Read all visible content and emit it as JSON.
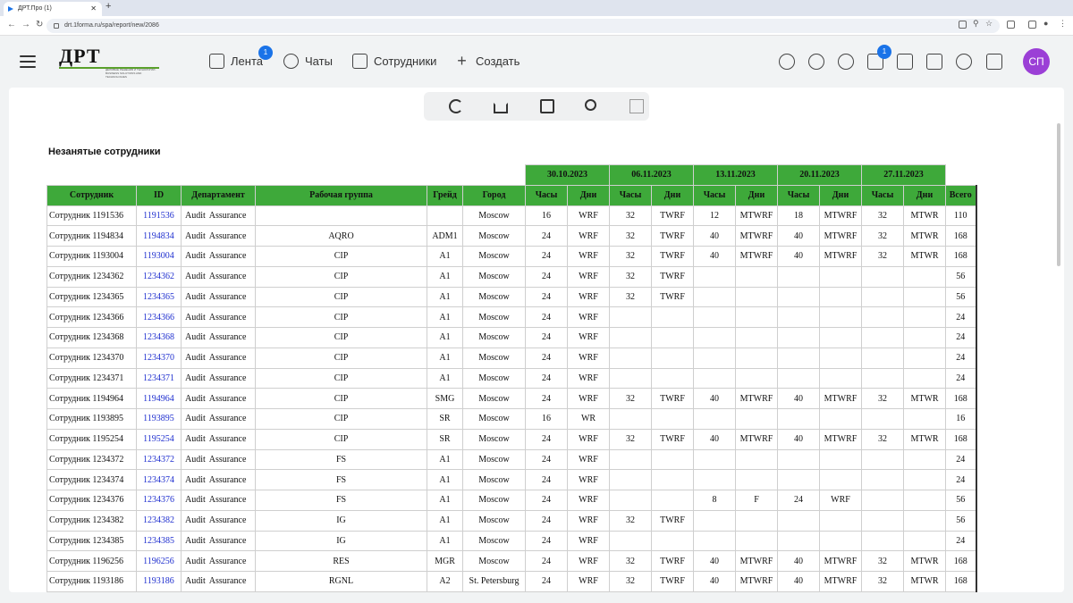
{
  "browser": {
    "tab_title": "ДРТ.Про (1)",
    "url": "drt.1forma.ru/spa/report/new/2086"
  },
  "header": {
    "logo": "ДРТ",
    "logo_sub": "ДЕЛОВЫЕ РЕШЕНИЯ И ТЕХНОЛОГИИ · BUSINESS SOLUTIONS AND TECHNOLOGIES",
    "nav": {
      "feed": "Лента",
      "feed_badge": "1",
      "chats": "Чаты",
      "employees": "Сотрудники",
      "create": "Создать"
    },
    "mail_badge": "1",
    "avatar": "СП"
  },
  "report": {
    "title": "Незанятые сотрудники",
    "weeks": [
      "30.10.2023",
      "06.11.2023",
      "13.11.2023",
      "20.11.2023",
      "27.11.2023"
    ],
    "columns": {
      "employee": "Сотрудник",
      "id": "ID",
      "department": "Департамент",
      "workgroup": "Рабочая группа",
      "grade": "Грейд",
      "city": "Город",
      "hours": "Часы",
      "days": "Дни",
      "total": "Всего"
    },
    "rows": [
      {
        "name": "Сотрудник 1191536",
        "id": "1191536",
        "dept": "Audit  Assurance",
        "group": "",
        "grade": "",
        "city": "Moscow",
        "w": [
          "16",
          "WRF",
          "32",
          "TWRF",
          "12",
          "MTWRF",
          "18",
          "MTWRF",
          "32",
          "MTWR"
        ],
        "total": "110"
      },
      {
        "name": "Сотрудник 1194834",
        "id": "1194834",
        "dept": "Audit  Assurance",
        "group": "AQRO",
        "grade": "ADM1",
        "city": "Moscow",
        "w": [
          "24",
          "WRF",
          "32",
          "TWRF",
          "40",
          "MTWRF",
          "40",
          "MTWRF",
          "32",
          "MTWR"
        ],
        "total": "168"
      },
      {
        "name": "Сотрудник 1193004",
        "id": "1193004",
        "dept": "Audit  Assurance",
        "group": "CIP",
        "grade": "A1",
        "city": "Moscow",
        "w": [
          "24",
          "WRF",
          "32",
          "TWRF",
          "40",
          "MTWRF",
          "40",
          "MTWRF",
          "32",
          "MTWR"
        ],
        "total": "168"
      },
      {
        "name": "Сотрудник 1234362",
        "id": "1234362",
        "dept": "Audit  Assurance",
        "group": "CIP",
        "grade": "A1",
        "city": "Moscow",
        "w": [
          "24",
          "WRF",
          "32",
          "TWRF",
          "",
          "",
          "",
          "",
          "",
          ""
        ],
        "total": "56"
      },
      {
        "name": "Сотрудник 1234365",
        "id": "1234365",
        "dept": "Audit  Assurance",
        "group": "CIP",
        "grade": "A1",
        "city": "Moscow",
        "w": [
          "24",
          "WRF",
          "32",
          "TWRF",
          "",
          "",
          "",
          "",
          "",
          ""
        ],
        "total": "56"
      },
      {
        "name": "Сотрудник 1234366",
        "id": "1234366",
        "dept": "Audit  Assurance",
        "group": "CIP",
        "grade": "A1",
        "city": "Moscow",
        "w": [
          "24",
          "WRF",
          "",
          "",
          "",
          "",
          "",
          "",
          "",
          ""
        ],
        "total": "24"
      },
      {
        "name": "Сотрудник 1234368",
        "id": "1234368",
        "dept": "Audit  Assurance",
        "group": "CIP",
        "grade": "A1",
        "city": "Moscow",
        "w": [
          "24",
          "WRF",
          "",
          "",
          "",
          "",
          "",
          "",
          "",
          ""
        ],
        "total": "24"
      },
      {
        "name": "Сотрудник 1234370",
        "id": "1234370",
        "dept": "Audit  Assurance",
        "group": "CIP",
        "grade": "A1",
        "city": "Moscow",
        "w": [
          "24",
          "WRF",
          "",
          "",
          "",
          "",
          "",
          "",
          "",
          ""
        ],
        "total": "24"
      },
      {
        "name": "Сотрудник 1234371",
        "id": "1234371",
        "dept": "Audit  Assurance",
        "group": "CIP",
        "grade": "A1",
        "city": "Moscow",
        "w": [
          "24",
          "WRF",
          "",
          "",
          "",
          "",
          "",
          "",
          "",
          ""
        ],
        "total": "24"
      },
      {
        "name": "Сотрудник 1194964",
        "id": "1194964",
        "dept": "Audit  Assurance",
        "group": "CIP",
        "grade": "SMG",
        "city": "Moscow",
        "w": [
          "24",
          "WRF",
          "32",
          "TWRF",
          "40",
          "MTWRF",
          "40",
          "MTWRF",
          "32",
          "MTWR"
        ],
        "total": "168"
      },
      {
        "name": "Сотрудник 1193895",
        "id": "1193895",
        "dept": "Audit  Assurance",
        "group": "CIP",
        "grade": "SR",
        "city": "Moscow",
        "w": [
          "16",
          "WR",
          "",
          "",
          "",
          "",
          "",
          "",
          "",
          ""
        ],
        "total": "16"
      },
      {
        "name": "Сотрудник 1195254",
        "id": "1195254",
        "dept": "Audit  Assurance",
        "group": "CIP",
        "grade": "SR",
        "city": "Moscow",
        "w": [
          "24",
          "WRF",
          "32",
          "TWRF",
          "40",
          "MTWRF",
          "40",
          "MTWRF",
          "32",
          "MTWR"
        ],
        "total": "168"
      },
      {
        "name": "Сотрудник 1234372",
        "id": "1234372",
        "dept": "Audit  Assurance",
        "group": "FS",
        "grade": "A1",
        "city": "Moscow",
        "w": [
          "24",
          "WRF",
          "",
          "",
          "",
          "",
          "",
          "",
          "",
          ""
        ],
        "total": "24"
      },
      {
        "name": "Сотрудник 1234374",
        "id": "1234374",
        "dept": "Audit  Assurance",
        "group": "FS",
        "grade": "A1",
        "city": "Moscow",
        "w": [
          "24",
          "WRF",
          "",
          "",
          "",
          "",
          "",
          "",
          "",
          ""
        ],
        "total": "24"
      },
      {
        "name": "Сотрудник 1234376",
        "id": "1234376",
        "dept": "Audit  Assurance",
        "group": "FS",
        "grade": "A1",
        "city": "Moscow",
        "w": [
          "24",
          "WRF",
          "",
          "",
          "8",
          "F",
          "24",
          "WRF",
          "",
          ""
        ],
        "total": "56"
      },
      {
        "name": "Сотрудник 1234382",
        "id": "1234382",
        "dept": "Audit  Assurance",
        "group": "IG",
        "grade": "A1",
        "city": "Moscow",
        "w": [
          "24",
          "WRF",
          "32",
          "TWRF",
          "",
          "",
          "",
          "",
          "",
          ""
        ],
        "total": "56"
      },
      {
        "name": "Сотрудник 1234385",
        "id": "1234385",
        "dept": "Audit  Assurance",
        "group": "IG",
        "grade": "A1",
        "city": "Moscow",
        "w": [
          "24",
          "WRF",
          "",
          "",
          "",
          "",
          "",
          "",
          "",
          ""
        ],
        "total": "24"
      },
      {
        "name": "Сотрудник 1196256",
        "id": "1196256",
        "dept": "Audit  Assurance",
        "group": "RES",
        "grade": "MGR",
        "city": "Moscow",
        "w": [
          "24",
          "WRF",
          "32",
          "TWRF",
          "40",
          "MTWRF",
          "40",
          "MTWRF",
          "32",
          "MTWR"
        ],
        "total": "168"
      },
      {
        "name": "Сотрудник 1193186",
        "id": "1193186",
        "dept": "Audit  Assurance",
        "group": "RGNL",
        "grade": "A2",
        "city": "St. Petersburg",
        "w": [
          "24",
          "WRF",
          "32",
          "TWRF",
          "40",
          "MTWRF",
          "40",
          "MTWRF",
          "32",
          "MTWR"
        ],
        "total": "168"
      }
    ]
  }
}
